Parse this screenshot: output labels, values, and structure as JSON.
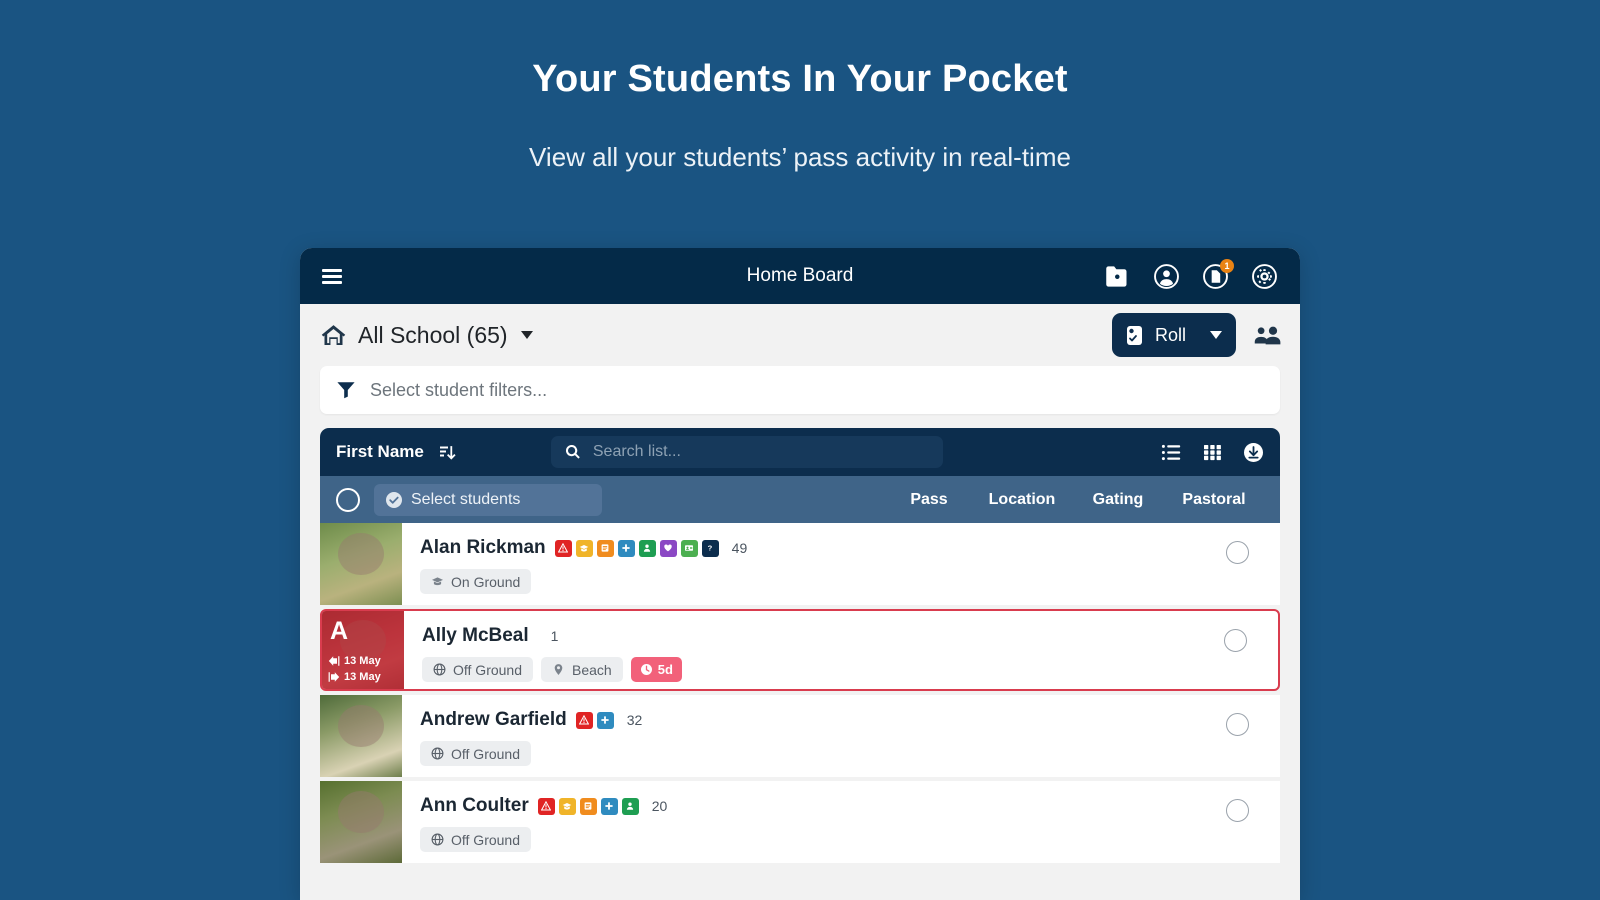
{
  "hero": {
    "title": "Your Students In Your Pocket",
    "subtitle": "View all your students’ pass activity in real-time"
  },
  "colors": {
    "page_background": "#1a5482",
    "appbar": "#042a48",
    "toolbar": "#0c2d4d",
    "column_header": "#3f6488",
    "alert_border": "#d93c4e",
    "badge_orange": "#e98314",
    "chip_red": "#f2617a"
  },
  "appbar": {
    "menu_icon": "hamburger-icon",
    "title": "Home Board",
    "actions": [
      {
        "name": "folder-user-icon",
        "badge": null
      },
      {
        "name": "user-circle-icon",
        "badge": null
      },
      {
        "name": "document-circle-icon",
        "badge": "1"
      },
      {
        "name": "gear-circle-icon",
        "badge": null
      }
    ]
  },
  "school_row": {
    "home_icon": "home-icon",
    "school_label": "All School (65)",
    "dropdown_icon": "chevron-down-icon",
    "roll_button": {
      "label": "Roll",
      "icon": "roll-clipboard-icon",
      "caret": "chevron-down-icon"
    },
    "people_icon": "people-group-icon"
  },
  "filter": {
    "icon": "funnel-icon",
    "placeholder": "Select student filters..."
  },
  "list_toolbar": {
    "sort_label": "First Name",
    "sort_icon": "sort-amount-down-icon",
    "search_icon": "search-icon",
    "search_placeholder": "Search list...",
    "search_value": "",
    "view_icons": [
      "list-view-icon",
      "grid-view-icon",
      "download-icon"
    ]
  },
  "column_header": {
    "select_all_icon": "select-all-circle-icon",
    "select_students_label": "Select students",
    "select_students_icon": "check-circle-icon",
    "columns": [
      "Pass",
      "Location",
      "Gating",
      "Pastoral"
    ]
  },
  "students": [
    {
      "name": "Alan Rickman",
      "count": "49",
      "alert": false,
      "avatar_kind": "photo",
      "avatar_letter": "",
      "avatar_gradient": "linear-gradient(160deg,#6e8c4a 0%,#9bae6e 40%,#b9b27e 70%,#7d8f52 100%)",
      "checkin_date": "",
      "checkout_date": "",
      "flags": [
        {
          "name": "alert-triangle-flag",
          "color": "#e02424",
          "glyph": "warn"
        },
        {
          "name": "graduation-cap-flag",
          "color": "#f0b429",
          "glyph": "cap"
        },
        {
          "name": "notes-flag",
          "color": "#f08c1e",
          "glyph": "lines"
        },
        {
          "name": "medical-cross-flag",
          "color": "#2f8bbf",
          "glyph": "plus"
        },
        {
          "name": "person-flag",
          "color": "#1e9e52",
          "glyph": "person"
        },
        {
          "name": "heart-shield-flag",
          "color": "#8b48c4",
          "glyph": "heart"
        },
        {
          "name": "id-card-flag",
          "color": "#4caf50",
          "glyph": "card"
        },
        {
          "name": "question-flag",
          "color": "#0c2d4d",
          "glyph": "question"
        }
      ],
      "chips": [
        {
          "name": "location-chip",
          "icon": "graduation-cap-icon",
          "label": "On Ground"
        }
      ],
      "time_chip": null
    },
    {
      "name": "Ally McBeal",
      "count": "1",
      "alert": true,
      "avatar_kind": "overlay",
      "avatar_letter": "A",
      "avatar_gradient": "linear-gradient(160deg,#8e2f36 0%,#b94750 45%,#c55a5f 70%,#9c3a40 100%)",
      "checkin_date": "13 May",
      "checkout_date": "13 May",
      "flags": [],
      "chips": [
        {
          "name": "location-chip",
          "icon": "globe-icon",
          "label": "Off Ground"
        },
        {
          "name": "place-chip",
          "icon": "map-pin-icon",
          "label": "Beach"
        }
      ],
      "time_chip": {
        "name": "overdue-chip",
        "icon": "clock-icon",
        "label": "5d"
      }
    },
    {
      "name": "Andrew Garfield",
      "count": "32",
      "alert": false,
      "avatar_kind": "photo",
      "avatar_letter": "",
      "avatar_gradient": "linear-gradient(160deg,#4f6b3a 0%,#8a9a66 35%,#d9d2b4 75%,#6e7f4c 100%)",
      "checkin_date": "",
      "checkout_date": "",
      "flags": [
        {
          "name": "alert-triangle-flag",
          "color": "#e02424",
          "glyph": "warn"
        },
        {
          "name": "medical-cross-flag",
          "color": "#2f8bbf",
          "glyph": "plus"
        }
      ],
      "chips": [
        {
          "name": "location-chip",
          "icon": "globe-icon",
          "label": "Off Ground"
        }
      ],
      "time_chip": null
    },
    {
      "name": "Ann Coulter",
      "count": "20",
      "alert": false,
      "avatar_kind": "photo",
      "avatar_letter": "",
      "avatar_gradient": "linear-gradient(160deg,#56702f 0%,#7d8c52 35%,#9a9378 70%,#5d6a38 100%)",
      "checkin_date": "",
      "checkout_date": "",
      "flags": [
        {
          "name": "alert-triangle-flag",
          "color": "#e02424",
          "glyph": "warn"
        },
        {
          "name": "graduation-cap-flag",
          "color": "#f0b429",
          "glyph": "cap"
        },
        {
          "name": "notes-flag",
          "color": "#f08c1e",
          "glyph": "lines"
        },
        {
          "name": "medical-cross-flag",
          "color": "#2f8bbf",
          "glyph": "plus"
        },
        {
          "name": "person-flag",
          "color": "#1e9e52",
          "glyph": "person"
        }
      ],
      "chips": [
        {
          "name": "location-chip",
          "icon": "globe-icon",
          "label": "Off Ground"
        }
      ],
      "time_chip": null
    }
  ]
}
